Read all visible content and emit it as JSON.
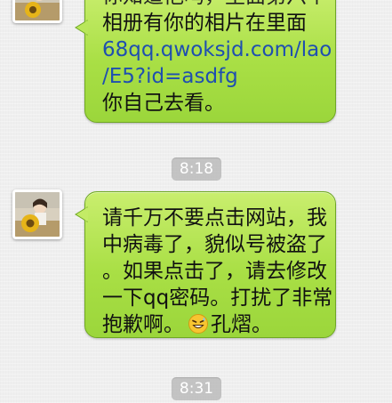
{
  "messages": [
    {
      "lines": [
        "你知道他吗，里面第六个",
        "相册有你的相片在里面",
        "68qq.qwoksjd.com/lao",
        "/E5?id=asdfg",
        "你自己去看。"
      ],
      "link_color": "#1f4fb0"
    },
    {
      "lines": [
        "请千万不要点击网站，我",
        "中病毒了，貌似号被盗了",
        "。如果点击了，请去修改",
        "一下qq密码。打扰了非常",
        "抱歉啊。",
        "孔熠。"
      ],
      "emoji_icon": "grinning-sweat-face-icon"
    }
  ],
  "timestamps": [
    "8:18",
    "8:31"
  ],
  "colors": {
    "bubble_green": "#a9df45",
    "bubble_border": "#6fa823",
    "background": "#efefef",
    "timestamp_bg": "#b4b4b4"
  }
}
